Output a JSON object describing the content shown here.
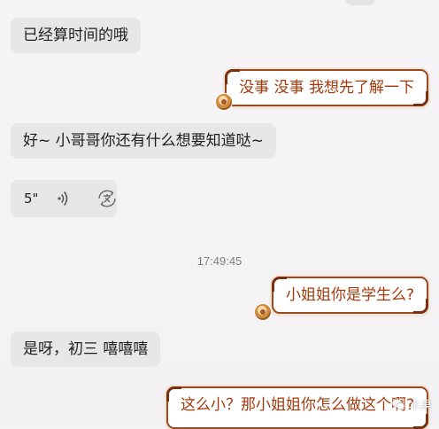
{
  "messages": [
    {
      "side": "in",
      "text": "已经算时间的哦"
    },
    {
      "side": "out",
      "text": "没事 没事 我想先了解一下"
    },
    {
      "side": "in",
      "text": "好~ 小哥哥你还有什么想要知道哒~"
    },
    {
      "side": "in",
      "type": "voice",
      "duration": "5\""
    },
    {
      "side": "out",
      "text": "小姐姐你是学生么?"
    },
    {
      "side": "in",
      "text": "是呀，初三 嘻嘻嘻"
    },
    {
      "side": "out",
      "text": "这么小？那小姐姐你怎么做这个啊?"
    }
  ],
  "timestamp": "17:49:45",
  "watermark": "水桌",
  "colors": {
    "background": "#f4f2f4",
    "incoming_bubble": "#e8e6e8",
    "outgoing_border": "#9a4a22",
    "outgoing_text": "#a33a0c"
  },
  "icons": {
    "voice_wave": "voice-wave-icon",
    "voice_to_text": "voice-to-text-icon",
    "bubble_decor": "bubble-decoration-icon",
    "watermark_logo": "wechat-logo-icon"
  }
}
